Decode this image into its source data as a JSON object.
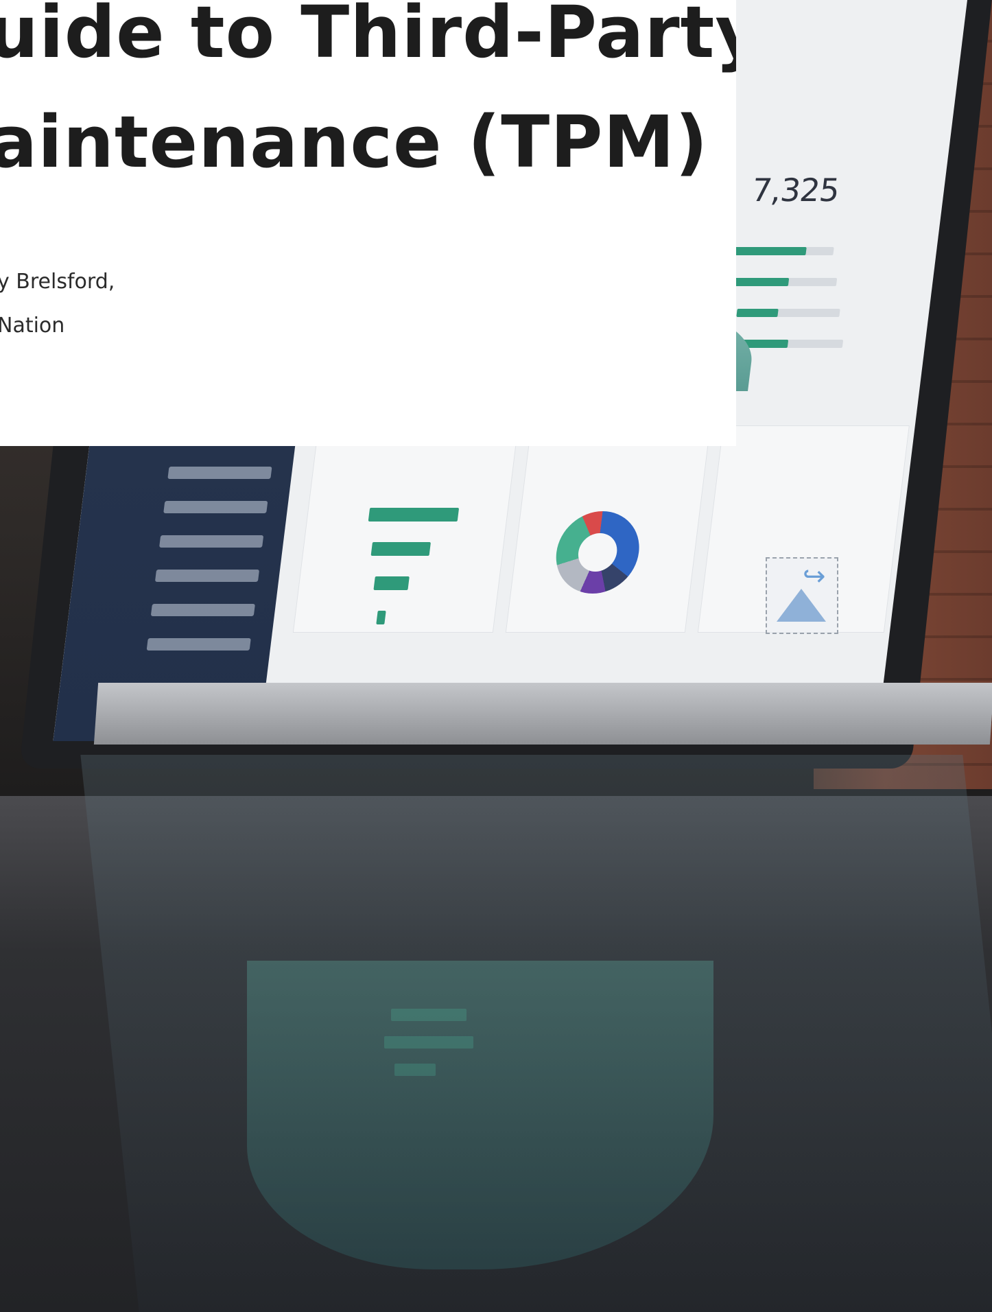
{
  "article": {
    "title_line_1": "uide to Third-Party",
    "title_line_2": "aintenance (TPM)",
    "byline_line_1": "y Brelsford,",
    "byline_line_2": "Nation"
  },
  "background_photo": {
    "dashboard_kpi": "7,325",
    "broken_image_icon": "broken-image-icon"
  },
  "colors": {
    "card_background": "#ffffff",
    "title_text": "#1d1d1d",
    "dashboard_accent": "#2f9a7a"
  }
}
